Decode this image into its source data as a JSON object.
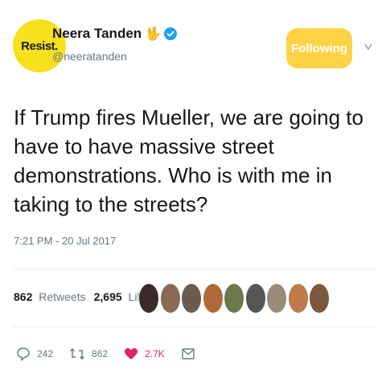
{
  "profile": {
    "avatar_text": "Resist.",
    "name": "Neera Tanden",
    "handle": "@neeratanden",
    "verified_icon": "verified-badge-icon",
    "emoji_icon": "vulcan-salute-hand"
  },
  "follow_button": {
    "label": "Following",
    "color": "#ffd246"
  },
  "tweet": {
    "text": "If Trump fires Mueller, we are going to have to have massive street demonstrations.  Who is with me in taking to the streets?",
    "timestamp": "7:21 PM - 20 Jul 2017"
  },
  "stats": {
    "retweets_count": "862",
    "retweets_label": "Retweets",
    "likes_count": "2,695",
    "likes_label": "Likes"
  },
  "likers": [
    {
      "color": "#3a2a2a"
    },
    {
      "color": "#8a6a55"
    },
    {
      "color": "#6b5a4e"
    },
    {
      "color": "#b06a3a"
    },
    {
      "color": "#6a7a4a"
    },
    {
      "color": "#555555"
    },
    {
      "color": "#9a8a7a"
    },
    {
      "color": "#c07a4a"
    },
    {
      "color": "#7a5a3a"
    }
  ],
  "actions": {
    "reply_count": "242",
    "retweet_count": "862",
    "like_count": "2.7K",
    "like_color": "#e0245e"
  }
}
